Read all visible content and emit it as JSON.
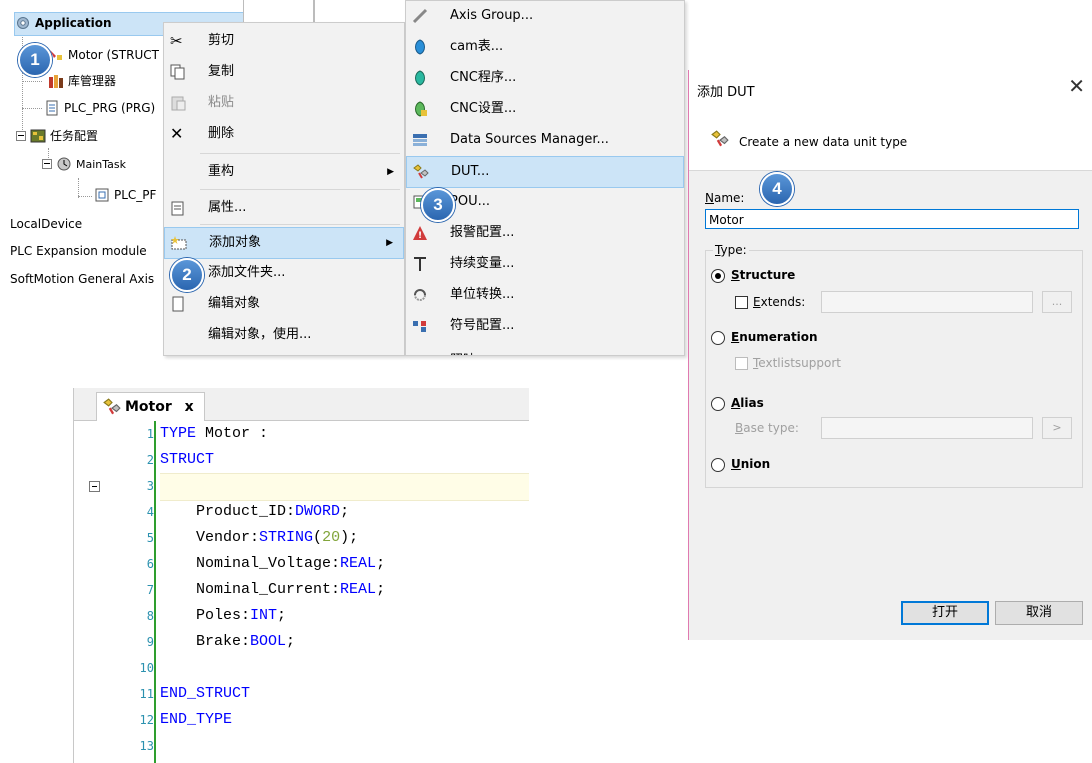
{
  "tree": {
    "items": [
      {
        "label": "Application"
      },
      {
        "label": "Motor (STRUCT"
      },
      {
        "label": "库管理器"
      },
      {
        "label": "PLC_PRG (PRG)"
      },
      {
        "label": "任务配置"
      },
      {
        "label": "MainTask"
      },
      {
        "label": "PLC_PF"
      },
      {
        "label": "LocalDevice"
      },
      {
        "label": "PLC Expansion module"
      },
      {
        "label": "SoftMotion General Axis"
      }
    ]
  },
  "context_menu": {
    "items": [
      {
        "label": "剪切"
      },
      {
        "label": "复制"
      },
      {
        "label": "粘贴"
      },
      {
        "label": "删除"
      },
      {
        "label": "重构"
      },
      {
        "label": "属性..."
      },
      {
        "label": "添加对象"
      },
      {
        "label": "添加文件夹..."
      },
      {
        "label": "编辑对象"
      },
      {
        "label": "编辑对象，使用..."
      }
    ]
  },
  "submenu": {
    "items": [
      {
        "label": "Axis Group..."
      },
      {
        "label": "cam表..."
      },
      {
        "label": "CNC程序..."
      },
      {
        "label": "CNC设置..."
      },
      {
        "label": "Data Sources Manager..."
      },
      {
        "label": "DUT..."
      },
      {
        "label": "POU..."
      },
      {
        "label": "报警配置..."
      },
      {
        "label": "持续变量..."
      },
      {
        "label": "单位转换..."
      },
      {
        "label": "符号配置..."
      },
      {
        "label": "照映"
      }
    ]
  },
  "badges": [
    "1",
    "2",
    "3",
    "4"
  ],
  "editor": {
    "tab_label": "Motor",
    "tab_close": "x",
    "line_numbers": [
      "1",
      "2",
      "3",
      "4",
      "5",
      "6",
      "7",
      "8",
      "9",
      "10",
      "11",
      "12",
      "13"
    ],
    "lines": [
      {
        "kw": "TYPE",
        "rest": " Motor :"
      },
      {
        "kw": "STRUCT",
        "rest": ""
      },
      {
        "kw": "",
        "rest": ""
      },
      {
        "indent": "    ",
        "name": "Product_ID:",
        "type": "DWORD",
        "end": ";"
      },
      {
        "indent": "    ",
        "name": "Vendor:",
        "type": "STRING",
        "paren_open": "(",
        "num": "20",
        "paren_close": ");"
      },
      {
        "indent": "    ",
        "name": "Nominal_Voltage:",
        "type": "REAL",
        "end": ";"
      },
      {
        "indent": "    ",
        "name": "Nominal_Current:",
        "type": "REAL",
        "end": ";"
      },
      {
        "indent": "    ",
        "name": "Poles:",
        "type": "INT",
        "end": ";"
      },
      {
        "indent": "    ",
        "name": "Brake:",
        "type": "BOOL",
        "end": ";"
      },
      {
        "kw": "",
        "rest": ""
      },
      {
        "kw": "END_STRUCT",
        "rest": ""
      },
      {
        "kw": "END_TYPE",
        "rest": ""
      },
      {
        "kw": "",
        "rest": ""
      }
    ]
  },
  "dialog": {
    "title": "添加 DUT",
    "close": "✕",
    "subtitle": "Create a new data unit type",
    "name_label_u": "N",
    "name_label_rest": "ame:",
    "name_value": "Motor",
    "type_label_u": "T",
    "type_label_rest": "ype:",
    "structure_u": "S",
    "structure_rest": "tructure",
    "extends_u": "E",
    "extends_rest": "xtends:",
    "extends_btn": "...",
    "enumeration_u": "E",
    "enumeration_rest": "numeration",
    "textlist_u": "T",
    "textlist_rest": "extlistsupport",
    "alias_u": "A",
    "alias_rest": "lias",
    "base_type_u": "B",
    "base_type_rest": "ase type:",
    "base_type_btn": ">",
    "union_u": "U",
    "union_rest": "nion",
    "open_button": "打开",
    "cancel_button": "取消",
    "selected_type": "Structure"
  }
}
